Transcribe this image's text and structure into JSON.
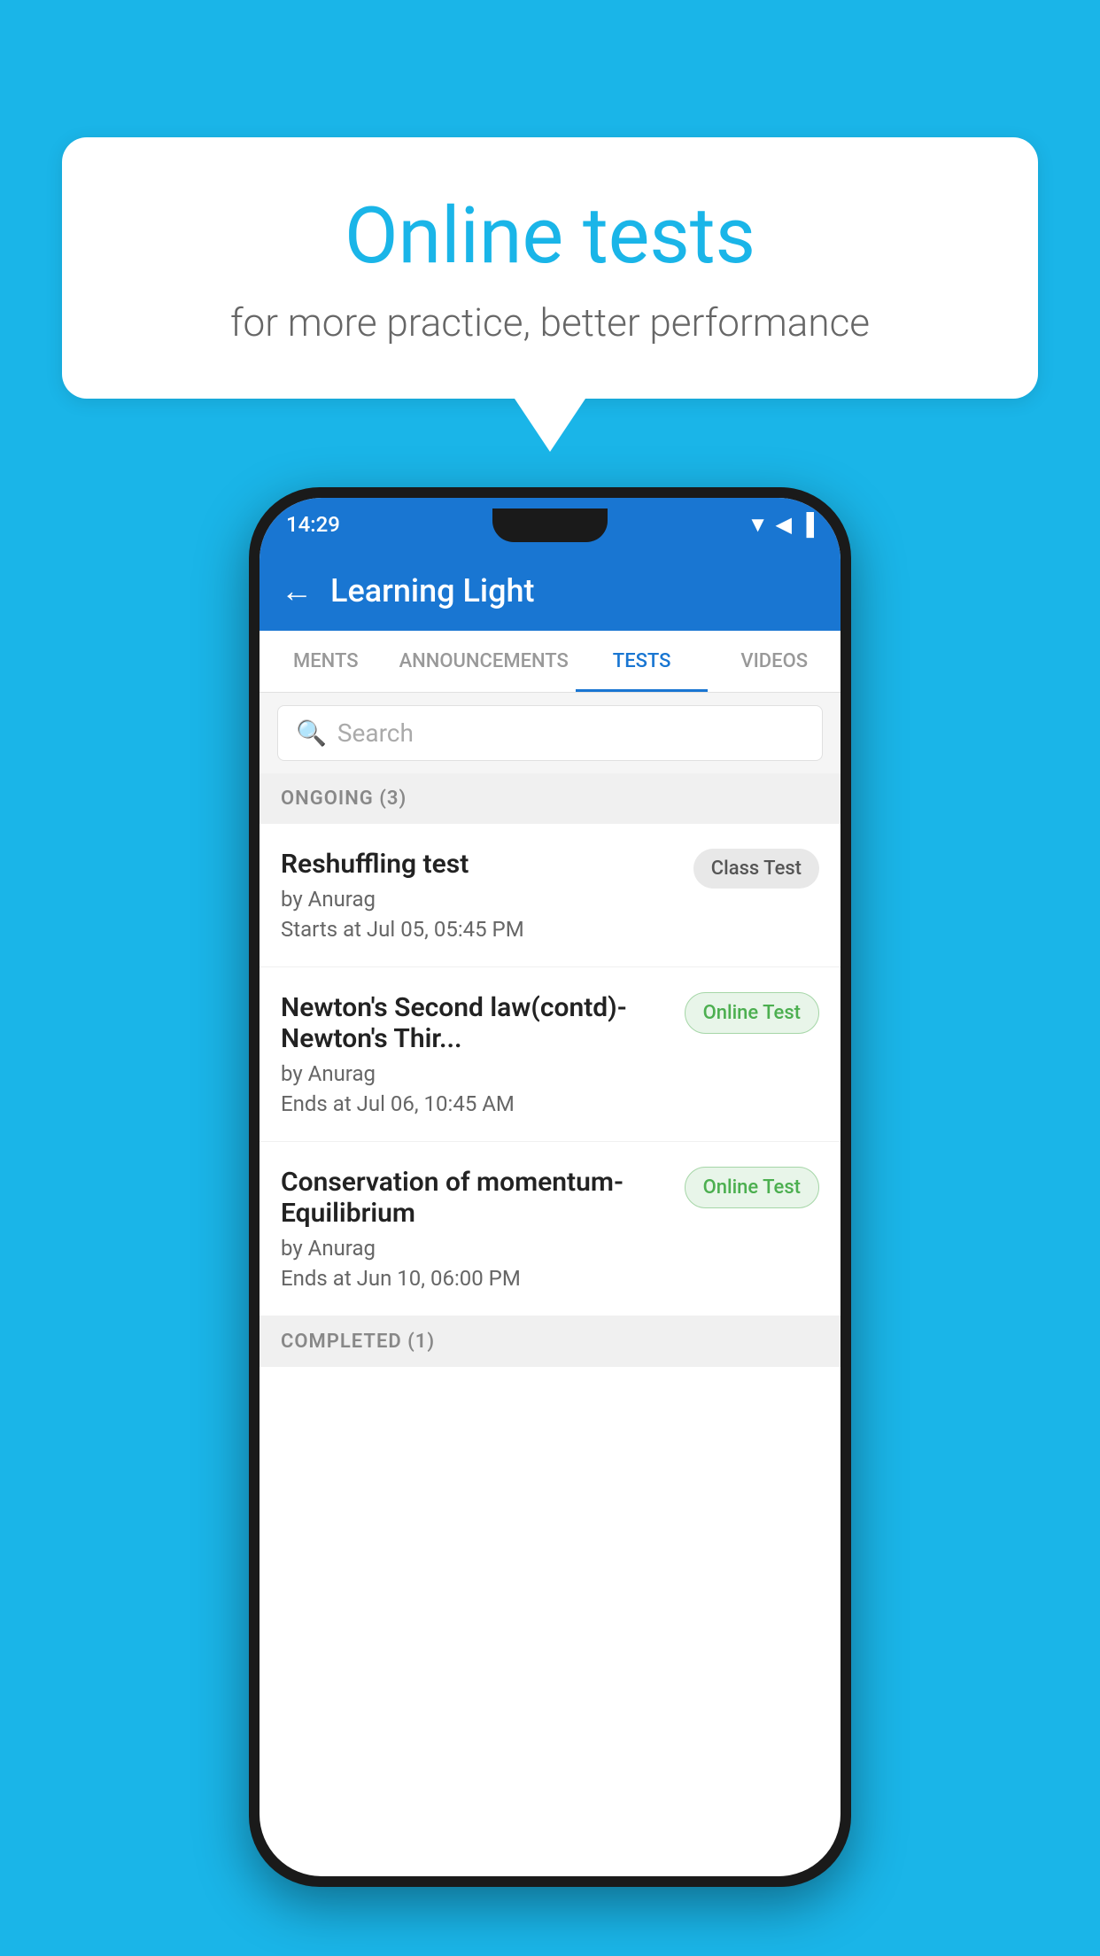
{
  "background_color": "#1ab5e8",
  "speech_bubble": {
    "title": "Online tests",
    "subtitle": "for more practice, better performance"
  },
  "phone": {
    "status_bar": {
      "time": "14:29",
      "icons": "▼◀▐"
    },
    "app_bar": {
      "title": "Learning Light",
      "back_label": "←"
    },
    "tabs": [
      {
        "label": "MENTS",
        "active": false
      },
      {
        "label": "ANNOUNCEMENTS",
        "active": false
      },
      {
        "label": "TESTS",
        "active": true
      },
      {
        "label": "VIDEOS",
        "active": false
      }
    ],
    "search": {
      "placeholder": "Search"
    },
    "sections": [
      {
        "header": "ONGOING (3)",
        "items": [
          {
            "name": "Reshuffling test",
            "author": "by Anurag",
            "date": "Starts at  Jul 05, 05:45 PM",
            "badge": "Class Test",
            "badge_type": "class"
          },
          {
            "name": "Newton's Second law(contd)-Newton's Thir...",
            "author": "by Anurag",
            "date": "Ends at  Jul 06, 10:45 AM",
            "badge": "Online Test",
            "badge_type": "online"
          },
          {
            "name": "Conservation of momentum-Equilibrium",
            "author": "by Anurag",
            "date": "Ends at  Jun 10, 06:00 PM",
            "badge": "Online Test",
            "badge_type": "online"
          }
        ]
      }
    ],
    "completed_section": {
      "header": "COMPLETED (1)"
    }
  }
}
